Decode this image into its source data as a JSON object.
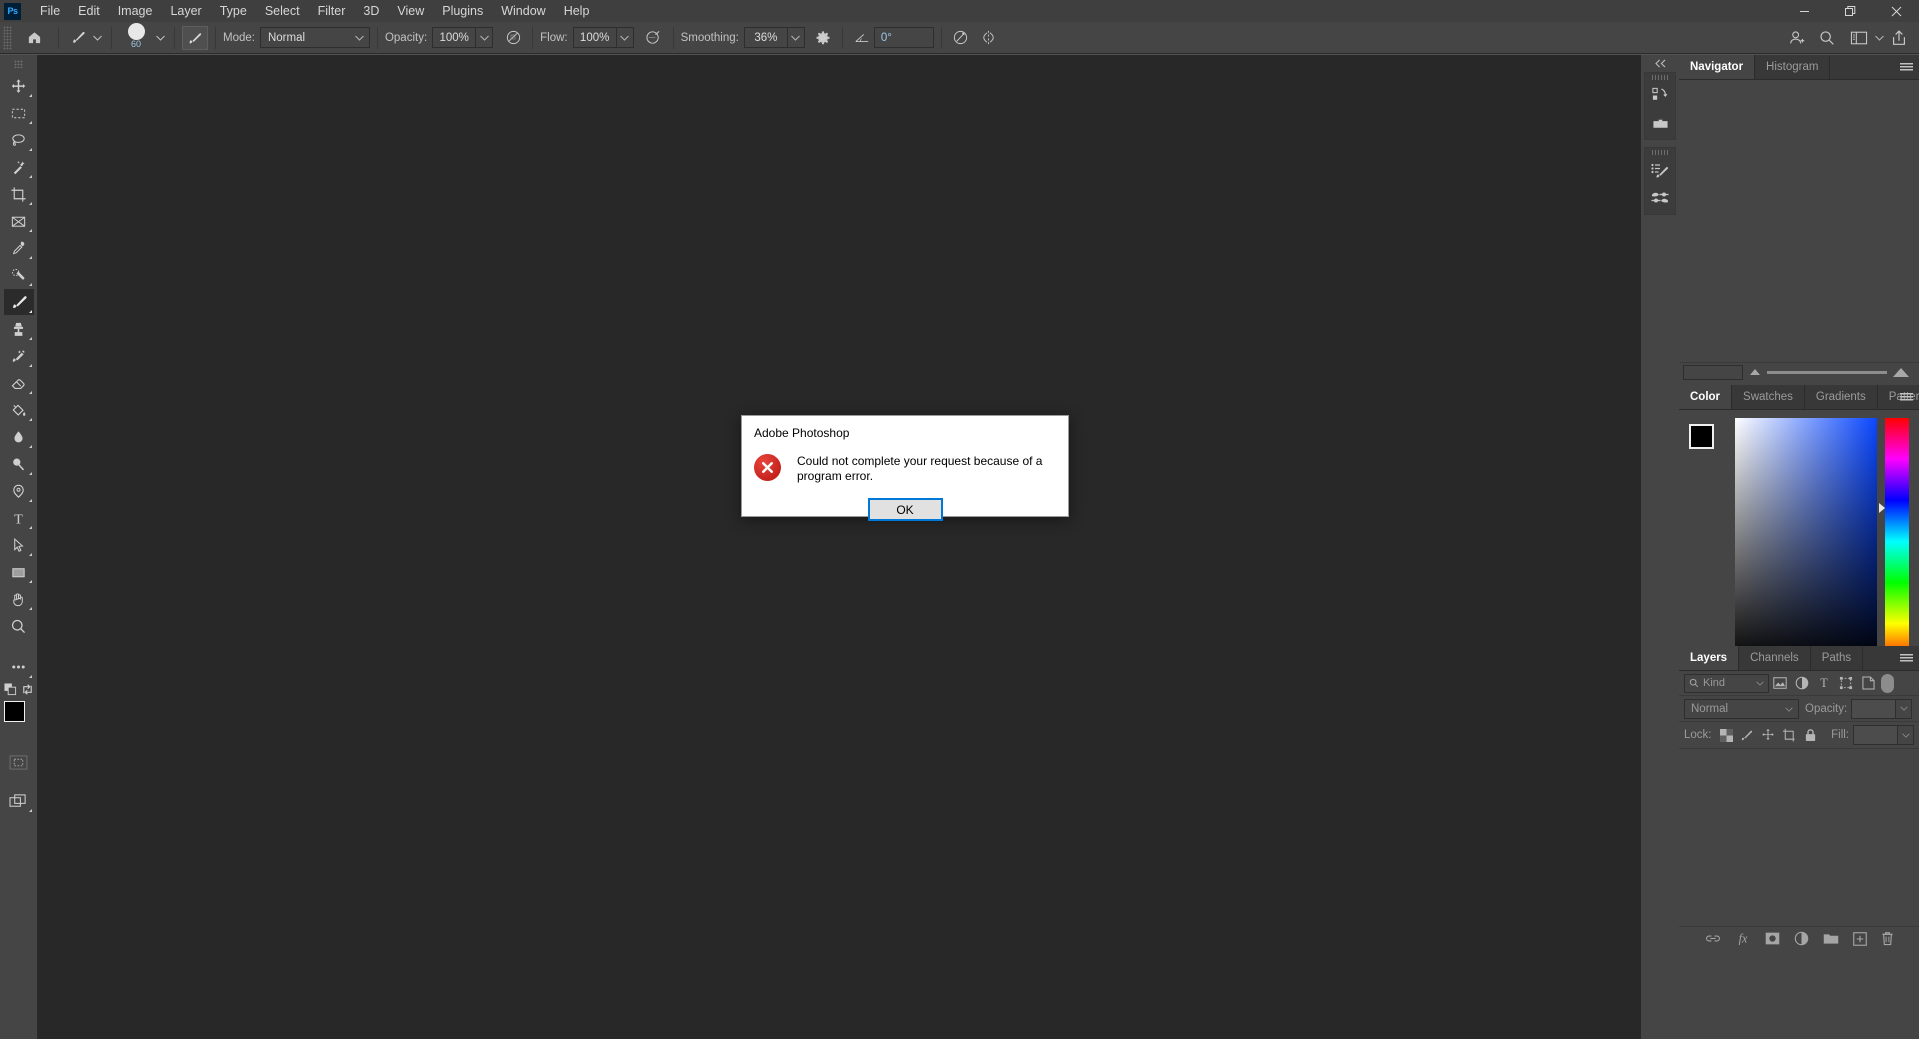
{
  "app": {
    "name": "Adobe Photoshop",
    "logo_text": "Ps"
  },
  "menubar": {
    "items": [
      {
        "label": "File"
      },
      {
        "label": "Edit"
      },
      {
        "label": "Image"
      },
      {
        "label": "Layer"
      },
      {
        "label": "Type"
      },
      {
        "label": "Select"
      },
      {
        "label": "Filter"
      },
      {
        "label": "3D"
      },
      {
        "label": "View"
      },
      {
        "label": "Plugins"
      },
      {
        "label": "Window"
      },
      {
        "label": "Help"
      }
    ]
  },
  "window_controls": {
    "minimize": "minimize-icon",
    "restore": "restore-icon",
    "close": "close-icon"
  },
  "options_bar": {
    "home_icon": "home-icon",
    "tool_preset_icon": "brush-tool-icon",
    "brush_size": "60",
    "brush_settings_icon": "brush-panel-icon",
    "mode_label": "Mode:",
    "mode_value": "Normal",
    "opacity_label": "Opacity:",
    "opacity_value": "100%",
    "pressure_opacity_icon": "pressure-opacity-icon",
    "flow_label": "Flow:",
    "flow_value": "100%",
    "airbrush_icon": "airbrush-icon",
    "smoothing_label": "Smoothing:",
    "smoothing_value": "36%",
    "smoothing_options_icon": "gear-icon",
    "angle_value": "0°",
    "pressure_size_icon": "pressure-size-icon",
    "symmetry_icon": "symmetry-icon",
    "share_user_icon": "add-collaborator-icon",
    "search_icon": "search-icon",
    "workspace_icon": "workspace-layout-icon",
    "workspace_chevron_icon": "chevron-down-icon",
    "export_icon": "share-export-icon"
  },
  "toolbar": {
    "tools": [
      {
        "name": "move-tool",
        "label": "Move Tool",
        "active": false
      },
      {
        "name": "marquee-tool",
        "label": "Rectangular Marquee Tool",
        "active": false
      },
      {
        "name": "lasso-tool",
        "label": "Lasso Tool",
        "active": false
      },
      {
        "name": "magic-wand-tool",
        "label": "Object Selection Tool",
        "active": false
      },
      {
        "name": "crop-tool",
        "label": "Crop Tool",
        "active": false
      },
      {
        "name": "frame-tool",
        "label": "Frame Tool",
        "active": false
      },
      {
        "name": "eyedropper-tool",
        "label": "Eyedropper Tool",
        "active": false
      },
      {
        "name": "healing-brush-tool",
        "label": "Spot Healing Brush Tool",
        "active": false
      },
      {
        "name": "brush-tool",
        "label": "Brush Tool",
        "active": true
      },
      {
        "name": "clone-stamp-tool",
        "label": "Clone Stamp Tool",
        "active": false
      },
      {
        "name": "history-brush-tool",
        "label": "History Brush Tool",
        "active": false
      },
      {
        "name": "eraser-tool",
        "label": "Eraser Tool",
        "active": false
      },
      {
        "name": "paint-bucket-tool",
        "label": "Gradient Tool",
        "active": false
      },
      {
        "name": "blur-tool",
        "label": "Blur Tool",
        "active": false
      },
      {
        "name": "dodge-tool",
        "label": "Dodge Tool",
        "active": false
      },
      {
        "name": "pen-tool",
        "label": "Pen Tool",
        "active": false
      },
      {
        "name": "type-tool",
        "label": "Horizontal Type Tool",
        "active": false
      },
      {
        "name": "path-selection-tool",
        "label": "Path Selection Tool",
        "active": false
      },
      {
        "name": "rectangle-tool",
        "label": "Rectangle Tool",
        "active": false
      },
      {
        "name": "hand-tool",
        "label": "Hand Tool",
        "active": false
      },
      {
        "name": "zoom-tool",
        "label": "Zoom Tool",
        "active": false
      },
      {
        "name": "edit-toolbar-button",
        "label": "Edit Toolbar",
        "active": false
      }
    ],
    "foreground_color": "#000000",
    "background_color": "#3a3a3a",
    "quick_mask_icon": "quick-mask-icon",
    "screen_mode_icon": "screen-mode-icon",
    "default_colors_icon": "default-colors-icon",
    "swap_colors_icon": "swap-colors-icon"
  },
  "icon_rail": {
    "collapse_icon": "collapse-panels-icon",
    "groups": [
      {
        "icons": [
          {
            "name": "history-panel-icon"
          },
          {
            "name": "libraries-panel-icon"
          }
        ]
      },
      {
        "icons": [
          {
            "name": "brush-settings-panel-icon"
          },
          {
            "name": "brushes-panel-icon"
          }
        ]
      }
    ]
  },
  "panels": {
    "navigator": {
      "tabs": [
        {
          "label": "Navigator",
          "active": true
        },
        {
          "label": "Histogram",
          "active": false
        }
      ],
      "menu_icon": "panel-menu-icon",
      "zoom_value": "",
      "zoom_out_icon": "zoom-out-triangle-icon",
      "zoom_in_icon": "zoom-in-triangle-icon"
    },
    "color": {
      "tabs": [
        {
          "label": "Color",
          "active": true
        },
        {
          "label": "Swatches",
          "active": false
        },
        {
          "label": "Gradients",
          "active": false
        },
        {
          "label": "Patterns",
          "active": false
        }
      ],
      "menu_icon": "panel-menu-icon",
      "foreground_color": "#000000",
      "background_color": "#3a3a3a",
      "field_gradient_from": "#ffffff",
      "field_gradient_to": "#0a47ff"
    },
    "layers": {
      "tabs": [
        {
          "label": "Layers",
          "active": true
        },
        {
          "label": "Channels",
          "active": false
        },
        {
          "label": "Paths",
          "active": false
        }
      ],
      "menu_icon": "panel-menu-icon",
      "filter_label": "Kind",
      "filter_search_icon": "search-icon",
      "filter_icons": [
        {
          "name": "filter-pixel-icon"
        },
        {
          "name": "filter-adjustment-icon"
        },
        {
          "name": "filter-type-icon"
        },
        {
          "name": "filter-shape-icon"
        },
        {
          "name": "filter-smart-object-icon"
        }
      ],
      "filter_toggle": "filter-enable-toggle",
      "blend_mode": "Normal",
      "opacity_label": "Opacity:",
      "opacity_value": "",
      "lock_label": "Lock:",
      "lock_icons": [
        {
          "name": "lock-transparent-pixels-icon"
        },
        {
          "name": "lock-image-pixels-icon"
        },
        {
          "name": "lock-position-icon"
        },
        {
          "name": "lock-artboard-nesting-icon"
        },
        {
          "name": "lock-all-icon"
        }
      ],
      "fill_label": "Fill:",
      "fill_value": "",
      "footer_icons": [
        {
          "name": "link-layers-icon"
        },
        {
          "name": "layer-style-fx-icon"
        },
        {
          "name": "add-layer-mask-icon"
        },
        {
          "name": "new-adjustment-layer-icon"
        },
        {
          "name": "new-group-icon"
        },
        {
          "name": "new-layer-icon"
        },
        {
          "name": "delete-layer-icon"
        }
      ]
    }
  },
  "dialog": {
    "title": "Adobe Photoshop",
    "icon": "error-icon",
    "message": "Could not complete your request because of a program error.",
    "ok_label": "OK",
    "accent_color": "#0078d7",
    "error_color": "#c5231c"
  }
}
